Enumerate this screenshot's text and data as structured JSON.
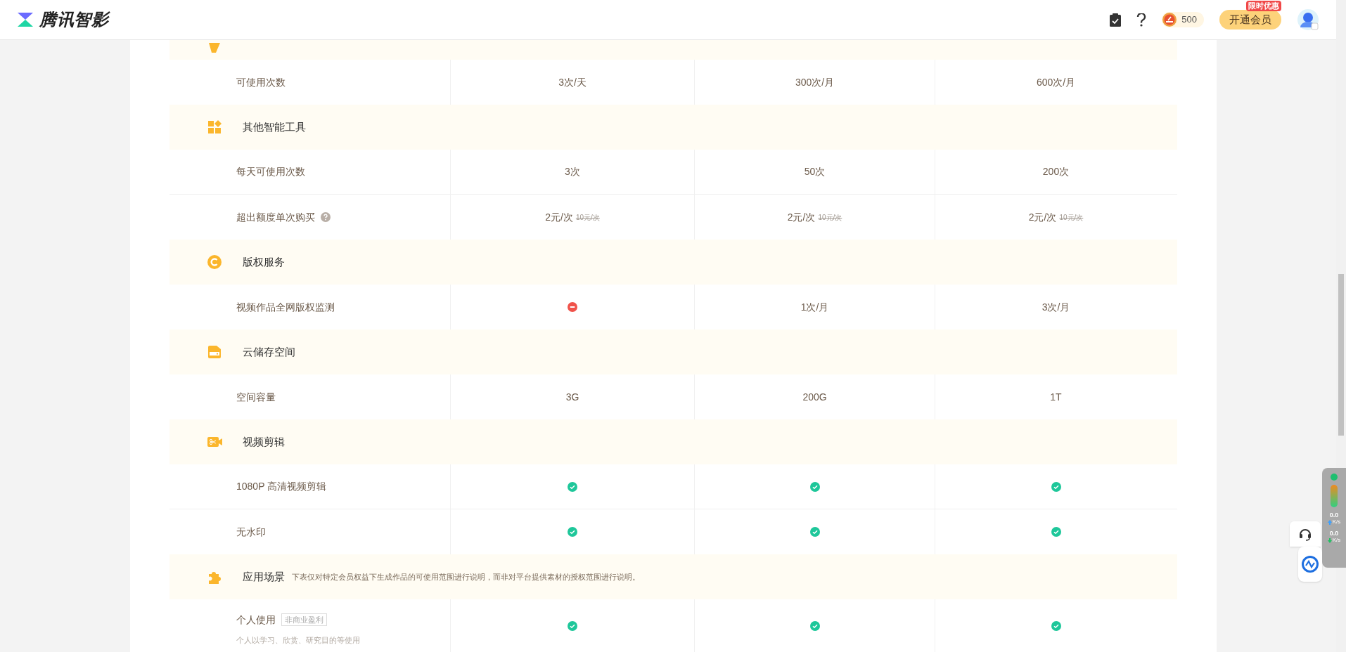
{
  "header": {
    "logo": "腾讯智影",
    "coins": "500",
    "vip_button": "开通会员",
    "vip_badge": "限时优惠"
  },
  "table": {
    "sections": [
      {
        "rows": [
          {
            "label": "可使用次数",
            "cells": [
              {
                "kind": "text",
                "text": "3次/天"
              },
              {
                "kind": "text",
                "text": "300次/月"
              },
              {
                "kind": "text",
                "text": "600次/月"
              }
            ]
          }
        ]
      },
      {
        "title": "其他智能工具",
        "rows": [
          {
            "label": "每天可使用次数",
            "cells": [
              {
                "kind": "text",
                "text": "3次"
              },
              {
                "kind": "text",
                "text": "50次"
              },
              {
                "kind": "text",
                "text": "200次"
              }
            ]
          },
          {
            "label": "超出额度单次购买",
            "help": true,
            "cells": [
              {
                "kind": "price",
                "text": "2元/次",
                "original": "10元/次"
              },
              {
                "kind": "price",
                "text": "2元/次",
                "original": "10元/次"
              },
              {
                "kind": "price",
                "text": "2元/次",
                "original": "10元/次"
              }
            ]
          }
        ]
      },
      {
        "title": "版权服务",
        "rows": [
          {
            "label": "视频作品全网版权监测",
            "cells": [
              {
                "kind": "none"
              },
              {
                "kind": "text",
                "text": "1次/月"
              },
              {
                "kind": "text",
                "text": "3次/月"
              }
            ]
          }
        ]
      },
      {
        "title": "云储存空间",
        "rows": [
          {
            "label": "空间容量",
            "cells": [
              {
                "kind": "text",
                "text": "3G"
              },
              {
                "kind": "text",
                "text": "200G"
              },
              {
                "kind": "text",
                "text": "1T"
              }
            ]
          }
        ]
      },
      {
        "title": "视频剪辑",
        "rows": [
          {
            "label": "1080P 高清视频剪辑",
            "cells": [
              {
                "kind": "check"
              },
              {
                "kind": "check"
              },
              {
                "kind": "check"
              }
            ]
          },
          {
            "label": "无水印",
            "cells": [
              {
                "kind": "check"
              },
              {
                "kind": "check"
              },
              {
                "kind": "check"
              }
            ]
          }
        ]
      },
      {
        "title": "应用场景",
        "note": "下表仅对特定会员权益下生成作品的可使用范围进行说明，而非对平台提供素材的授权范围进行说明。",
        "rows": [
          {
            "label": "个人使用",
            "tag": "非商业盈利",
            "subtitle": "个人以学习、欣赏、研究目的等使用",
            "cells": [
              {
                "kind": "check"
              },
              {
                "kind": "check"
              },
              {
                "kind": "check"
              }
            ]
          }
        ]
      }
    ]
  },
  "speed_widget": {
    "upload": "0.0",
    "upload_unit": "K/s",
    "download": "0.0",
    "download_unit": "K/s"
  }
}
